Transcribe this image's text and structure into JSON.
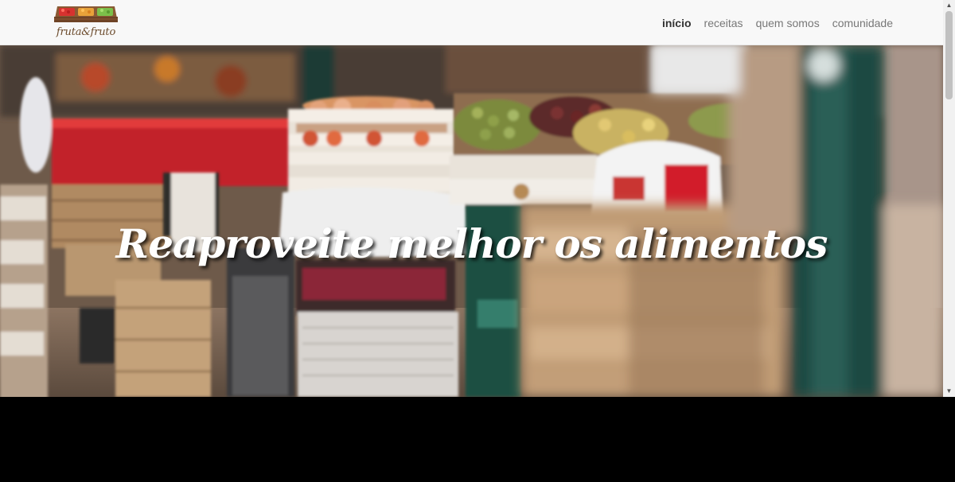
{
  "brand": {
    "logo_text": "fruta&fruto"
  },
  "nav": {
    "items": [
      {
        "label": "início",
        "active": true
      },
      {
        "label": "receitas",
        "active": false
      },
      {
        "label": "quem somos",
        "active": false
      },
      {
        "label": "comunidade",
        "active": false
      }
    ]
  },
  "hero": {
    "title": "Reaproveite melhor os alimentos"
  },
  "scrollbar": {
    "position_fraction": 0.0
  },
  "icons": {
    "scroll_up": "triangle-up",
    "scroll_down": "triangle-down"
  },
  "colors": {
    "navbar_bg": "#f8f8f8",
    "nav_active": "#333333",
    "nav_inactive": "#777777",
    "hero_title": "#ffffff",
    "page_bottom": "#000000"
  }
}
